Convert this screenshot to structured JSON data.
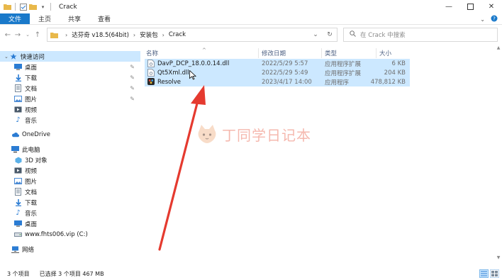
{
  "window": {
    "title": "Crack"
  },
  "ribbon": {
    "tabs": [
      "文件",
      "主页",
      "共享",
      "查看"
    ],
    "active_tab": 0
  },
  "address": {
    "crumbs": [
      "达芬奇 v18.5(64bit)",
      "安装包",
      "Crack"
    ]
  },
  "search": {
    "placeholder": "在 Crack 中搜索"
  },
  "nav": {
    "quick_access": "快速访问",
    "quick_items": [
      "桌面",
      "下载",
      "文档",
      "图片",
      "视频",
      "音乐"
    ],
    "onedrive": "OneDrive",
    "this_pc": "此电脑",
    "pc_items": [
      "3D 对象",
      "视频",
      "图片",
      "文档",
      "下载",
      "音乐",
      "桌面",
      "www.fhts006.vip (C:)"
    ],
    "network": "网络"
  },
  "columns": {
    "name": "名称",
    "date": "修改日期",
    "type": "类型",
    "size": "大小"
  },
  "files": [
    {
      "name": "DavP_DCP_18.0.0.14.dll",
      "date": "2022/5/29 5:57",
      "type": "应用程序扩展",
      "size": "6 KB",
      "icon": "dll-file-icon"
    },
    {
      "name": "Qt5Xml.dll",
      "date": "2022/5/29 5:49",
      "type": "应用程序扩展",
      "size": "204 KB",
      "icon": "dll-file-icon"
    },
    {
      "name": "Resolve",
      "date": "2023/4/17 14:00",
      "type": "应用程序",
      "size": "478,812 KB",
      "icon": "resolve-app-icon"
    }
  ],
  "watermark": {
    "text": "丁同学日记本"
  },
  "status": {
    "count": "3 个项目",
    "selected": "已选择 3 个项目  467 MB"
  },
  "colors": {
    "accent": "#1979ca",
    "selection": "#cce8ff",
    "arrow": "#e53a2f"
  }
}
